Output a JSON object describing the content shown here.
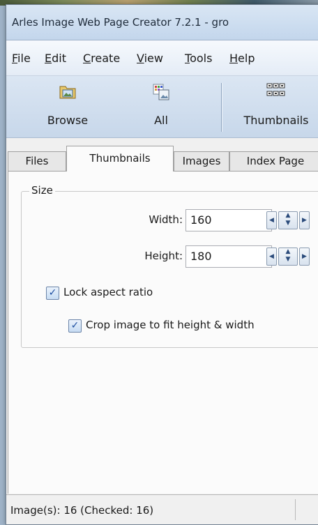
{
  "window": {
    "title": "Arles Image Web Page Creator 7.2.1 - gro"
  },
  "menu": [
    {
      "accel": "F",
      "rest": "ile"
    },
    {
      "accel": "E",
      "rest": "dit"
    },
    {
      "accel": "C",
      "rest": "reate"
    },
    {
      "accel": "V",
      "rest": "iew"
    },
    {
      "accel": "T",
      "rest": "ools"
    },
    {
      "accel": "H",
      "rest": "elp"
    }
  ],
  "toolbar": {
    "browse": "Browse",
    "all": "All",
    "thumbnails": "Thumbnails"
  },
  "tabs": [
    "Files",
    "Thumbnails",
    "Images",
    "Index Page"
  ],
  "active_tab": "Thumbnails",
  "size_group": {
    "legend": "Size",
    "width_label": "Width:",
    "width_value": "160",
    "height_label": "Height:",
    "height_value": "180"
  },
  "options": {
    "lock_aspect": {
      "label": "Lock aspect ratio",
      "checked": true
    },
    "crop": {
      "label": "Crop image to fit height & width",
      "checked": true
    }
  },
  "status": {
    "text": "Image(s): 16 (Checked: 16)"
  }
}
